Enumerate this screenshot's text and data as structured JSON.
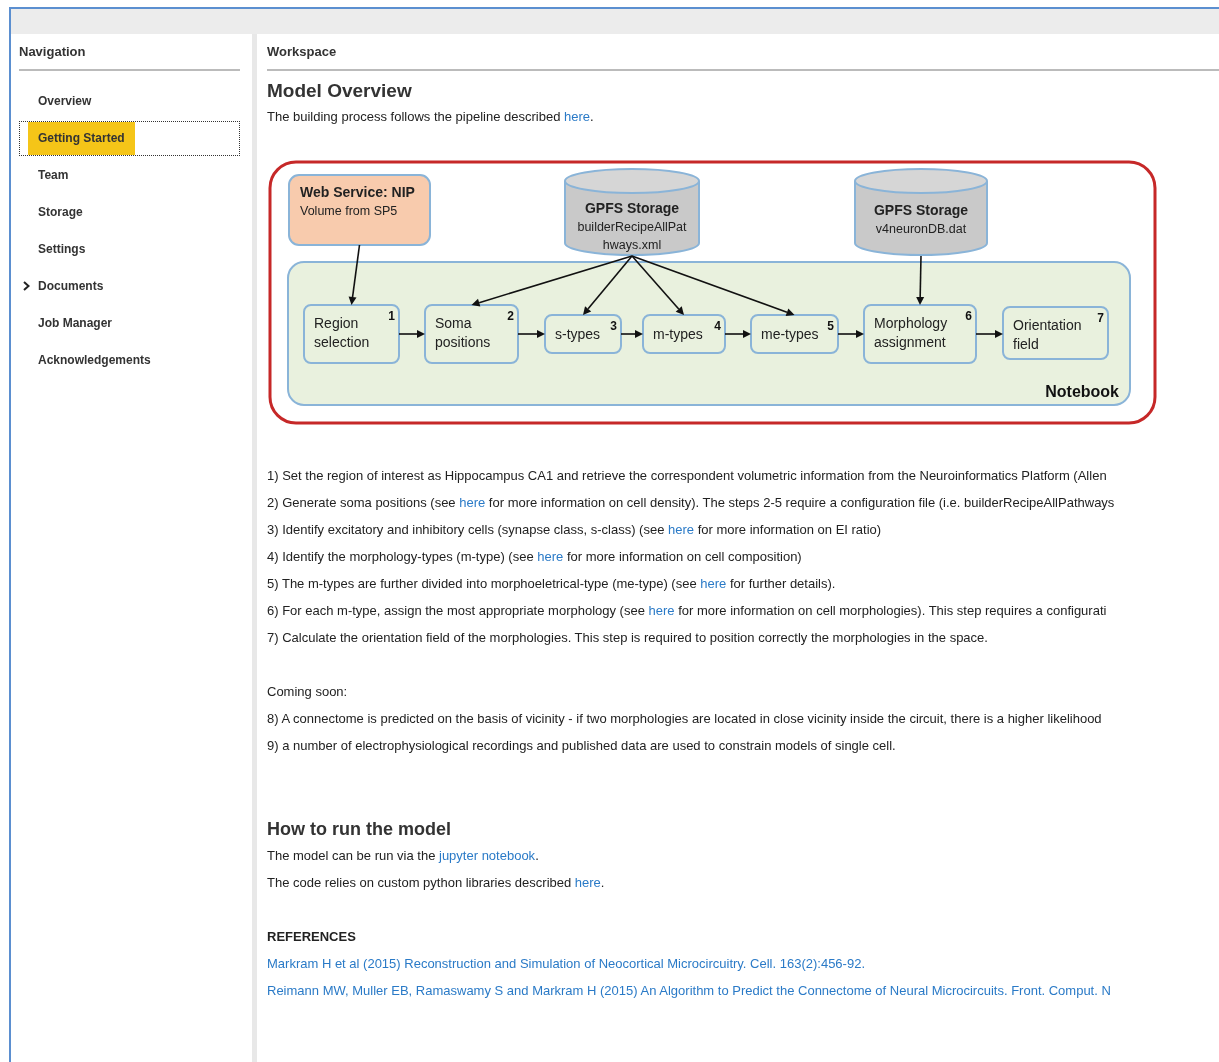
{
  "sidebar": {
    "title": "Navigation",
    "items": [
      {
        "label": "Overview",
        "kind": "page",
        "selected": false
      },
      {
        "label": "Getting Started",
        "kind": "page",
        "selected": true
      },
      {
        "label": "Team",
        "kind": "page",
        "selected": false
      },
      {
        "label": "Storage",
        "kind": "page",
        "selected": false
      },
      {
        "label": "Settings",
        "kind": "page",
        "selected": false
      },
      {
        "label": "Documents",
        "kind": "folder",
        "expanded": false,
        "selected": false
      },
      {
        "label": "Job Manager",
        "kind": "page",
        "selected": false
      },
      {
        "label": "Acknowledgements",
        "kind": "page",
        "selected": false
      }
    ]
  },
  "workspace": {
    "title": "Workspace",
    "heading": "Model Overview",
    "intro": [
      {
        "text": "The building process follows the pipeline described "
      },
      {
        "text": "here",
        "link": true
      },
      {
        "text": "."
      }
    ],
    "diagram": {
      "container_label": "Notebook",
      "nodes": [
        {
          "kind": "service",
          "lines": [
            "Web Service: NIP",
            "Volume from SP5"
          ]
        },
        {
          "kind": "storage",
          "lines": [
            "GPFS Storage",
            "builderRecipeAllPat",
            "hways.xml"
          ]
        },
        {
          "kind": "storage",
          "lines": [
            "GPFS Storage",
            "v4neuronDB.dat"
          ]
        },
        {
          "kind": "step",
          "lines": [
            "Region",
            "selection"
          ],
          "number": "1"
        },
        {
          "kind": "step",
          "lines": [
            "Soma",
            "positions"
          ],
          "number": "2"
        },
        {
          "kind": "step",
          "lines": [
            "s-types"
          ],
          "number": "3"
        },
        {
          "kind": "step",
          "lines": [
            "m-types"
          ],
          "number": "4"
        },
        {
          "kind": "step",
          "lines": [
            "me-types"
          ],
          "number": "5"
        },
        {
          "kind": "step",
          "lines": [
            "Morphology",
            "assignment"
          ],
          "number": "6"
        },
        {
          "kind": "step",
          "lines": [
            "Orientation",
            "field"
          ],
          "number": "7"
        }
      ]
    },
    "steps": [
      [
        {
          "text": "1) Set the region of interest as Hippocampus CA1 and retrieve the correspondent volumetric information from the Neuroinformatics Platform (Allen"
        }
      ],
      [
        {
          "text": "2) Generate soma positions (see "
        },
        {
          "text": "here",
          "link": true
        },
        {
          "text": " for more information on cell density). The steps 2-5 require a configuration file (i.e. builderRecipeAllPathways"
        }
      ],
      [
        {
          "text": "3) Identify excitatory and inhibitory cells (synapse class, s-class) (see "
        },
        {
          "text": "here",
          "link": true
        },
        {
          "text": " for more information on EI ratio)"
        }
      ],
      [
        {
          "text": "4) Identify the morphology-types (m-type) (see "
        },
        {
          "text": "here",
          "link": true
        },
        {
          "text": " for more information on cell composition)"
        }
      ],
      [
        {
          "text": "5) The m-types are further divided into morphoeletrical-type (me-type) (see "
        },
        {
          "text": "here",
          "link": true
        },
        {
          "text": " for further details)."
        }
      ],
      [
        {
          "text": "6) For each m-type, assign the most appropriate morphology (see "
        },
        {
          "text": "here",
          "link": true
        },
        {
          "text": " for more information on cell morphologies). This step requires a configurati"
        }
      ],
      [
        {
          "text": "7) Calculate the orientation field of the morphologies. This step is required to position correctly the morphologies in the space."
        }
      ]
    ],
    "coming_soon": {
      "title": "Coming soon:",
      "items": [
        [
          {
            "text": "8) A connectome is predicted on the basis of vicinity - if two morphologies are located in close vicinity inside the circuit, there is a higher likelihood"
          }
        ],
        [
          {
            "text": "9) a number of electrophysiological recordings and published data are used to constrain models of single cell."
          }
        ]
      ]
    },
    "run": {
      "heading": "How to run the model",
      "lines": [
        [
          {
            "text": "The model can be run via the "
          },
          {
            "text": "jupyter notebook",
            "link": true
          },
          {
            "text": "."
          }
        ],
        [
          {
            "text": "The code relies on custom python libraries described "
          },
          {
            "text": "here",
            "link": true
          },
          {
            "text": "."
          }
        ]
      ]
    },
    "references": {
      "title": "REFERENCES",
      "items": [
        "Markram H et al (2015) Reconstruction and Simulation of Neocortical Microcircuitry. Cell. 163(2):456-92.",
        "Reimann MW, Muller EB, Ramaswamy S and Markram H (2015) An Algorithm to Predict the Connectome of Neural Microcircuits. Front. Comput. N"
      ]
    }
  }
}
